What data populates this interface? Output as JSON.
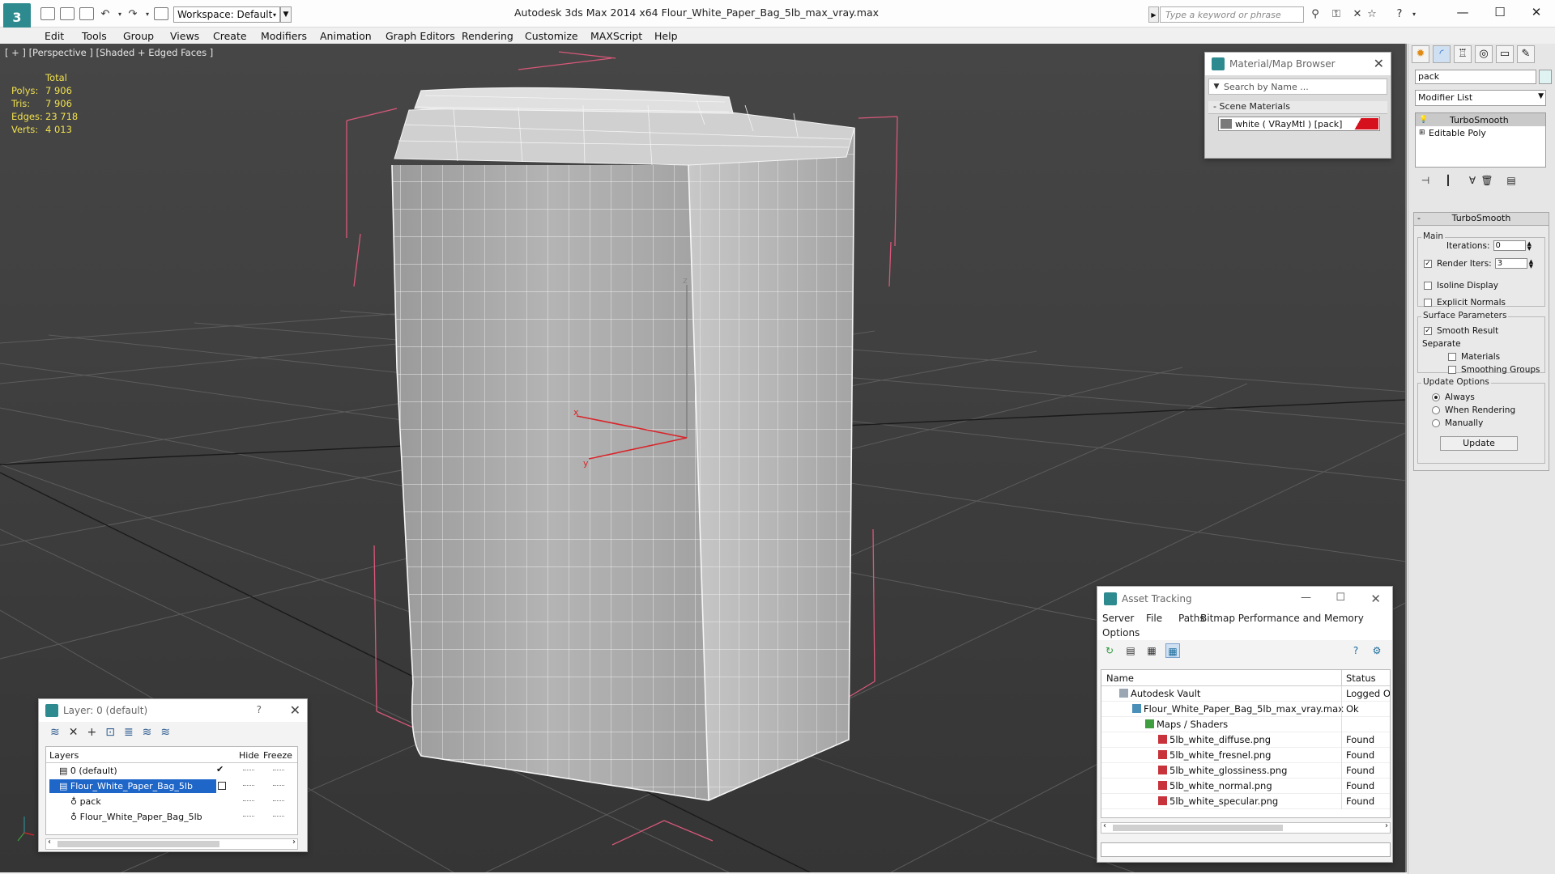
{
  "titlebar": {
    "workspace": "Workspace: Default",
    "title": "Autodesk 3ds Max  2014 x64      Flour_White_Paper_Bag_5lb_max_vray.max",
    "search_placeholder": "Type a keyword or phrase"
  },
  "menu": [
    "Edit",
    "Tools",
    "Group",
    "Views",
    "Create",
    "Modifiers",
    "Animation",
    "Graph Editors",
    "Rendering",
    "Customize",
    "MAXScript",
    "Help"
  ],
  "viewport": {
    "label": "[ + ] [Perspective ] [Shaded + Edged Faces ]",
    "stats": {
      "header": "Total",
      "rows": [
        {
          "key": "Polys:",
          "value": "7 906"
        },
        {
          "key": "Tris:",
          "value": "7 906"
        },
        {
          "key": "Edges:",
          "value": "23 718"
        },
        {
          "key": "Verts:",
          "value": "4 013"
        }
      ]
    },
    "gizmo_labels": {
      "z": "z",
      "x": "x",
      "y": "y"
    }
  },
  "material_browser": {
    "title": "Material/Map Browser",
    "search_placeholder": "Search by Name ...",
    "section": "Scene Materials",
    "entry": "white  ( VRayMtl )  [pack]"
  },
  "command_panel": {
    "object_name": "pack",
    "modifier_list": "Modifier List",
    "stack": [
      "TurboSmooth",
      "Editable Poly"
    ],
    "rollout_title": "TurboSmooth",
    "main_group": "Main",
    "iterations_label": "Iterations:",
    "iterations_value": "0",
    "render_iters_label": "Render Iters:",
    "render_iters_value": "3",
    "isoline": "Isoline Display",
    "explicit_normals": "Explicit Normals",
    "surface_group": "Surface Parameters",
    "smooth_result": "Smooth Result",
    "separate": "Separate",
    "materials": "Materials",
    "smoothing_groups": "Smoothing Groups",
    "update_group": "Update Options",
    "always": "Always",
    "when_rendering": "When Rendering",
    "manually": "Manually",
    "update_button": "Update"
  },
  "layer_explorer": {
    "title": "Layer: 0 (default)",
    "help": "?",
    "columns": {
      "layers": "Layers",
      "hide": "Hide",
      "freeze": "Freeze"
    },
    "rows": [
      {
        "name": "0 (default)"
      },
      {
        "name": "Flour_White_Paper_Bag_5lb"
      },
      {
        "name": "pack"
      },
      {
        "name": "Flour_White_Paper_Bag_5lb"
      }
    ]
  },
  "asset_tracking": {
    "title": "Asset Tracking",
    "menu": [
      "Server",
      "File",
      "Paths",
      "Bitmap Performance and Memory",
      "Options"
    ],
    "columns": {
      "name": "Name",
      "status": "Status"
    },
    "rows": [
      {
        "name": "Autodesk Vault",
        "status": "Logged Ou"
      },
      {
        "name": "Flour_White_Paper_Bag_5lb_max_vray.max",
        "status": "Ok"
      },
      {
        "name": "Maps / Shaders",
        "status": ""
      },
      {
        "name": "5lb_white_diffuse.png",
        "status": "Found"
      },
      {
        "name": "5lb_white_fresnel.png",
        "status": "Found"
      },
      {
        "name": "5lb_white_glossiness.png",
        "status": "Found"
      },
      {
        "name": "5lb_white_normal.png",
        "status": "Found"
      },
      {
        "name": "5lb_white_specular.png",
        "status": "Found"
      }
    ]
  },
  "colors": {
    "viewport_bg": "#3e3e3e",
    "stats_text": "#f0e04e",
    "selection_blue": "#1f66c9",
    "bracket_pink": "#d8587a",
    "wire_white": "#f4f4f4"
  }
}
